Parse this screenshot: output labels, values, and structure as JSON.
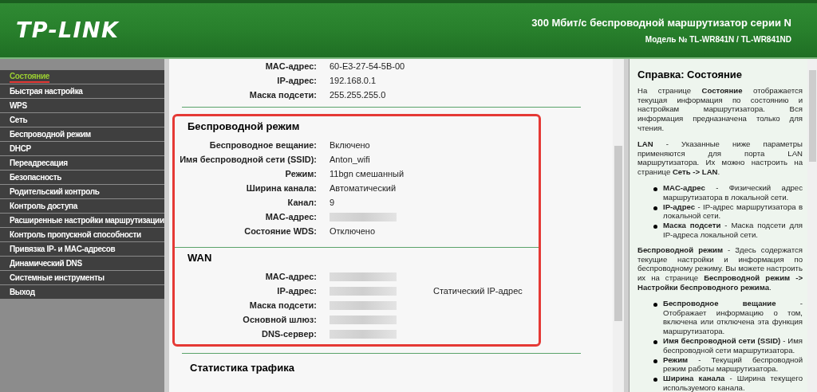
{
  "header": {
    "logo": "TP-LINK",
    "title": "300 Мбит/с беспроводной маршрутизатор серии N",
    "model": "Модель № TL-WR841N / TL-WR841ND"
  },
  "menu": [
    {
      "label": "Состояние",
      "selected": true
    },
    {
      "label": "Быстрая настройка",
      "selected": false
    },
    {
      "label": "WPS",
      "selected": false
    },
    {
      "label": "Сеть",
      "selected": false
    },
    {
      "label": "Беспроводной режим",
      "selected": false
    },
    {
      "label": "DHCP",
      "selected": false
    },
    {
      "label": "Переадресация",
      "selected": false
    },
    {
      "label": "Безопасность",
      "selected": false
    },
    {
      "label": "Родительский контроль",
      "selected": false
    },
    {
      "label": "Контроль доступа",
      "selected": false
    },
    {
      "label": "Расширенные настройки маршрутизации",
      "selected": false
    },
    {
      "label": "Контроль пропускной способности",
      "selected": false
    },
    {
      "label": "Привязка IP- и MAC-адресов",
      "selected": false
    },
    {
      "label": "Динамический DNS",
      "selected": false
    },
    {
      "label": "Системные инструменты",
      "selected": false
    },
    {
      "label": "Выход",
      "selected": false
    }
  ],
  "sections": [
    {
      "highlighted": false,
      "rows": [
        {
          "label": "MAC-адрес:",
          "value": "60-E3-27-54-5B-00"
        },
        {
          "label": "IP-адрес:",
          "value": "192.168.0.1"
        },
        {
          "label": "Маска подсети:",
          "value": "255.255.255.0"
        }
      ]
    },
    {
      "title": "Беспроводной режим",
      "highlighted": true,
      "rows": [
        {
          "label": "Беспроводное вещание:",
          "value": "Включено"
        },
        {
          "label": "Имя беспроводной сети (SSID):",
          "value": "Anton_wifi"
        },
        {
          "label": "Режим:",
          "value": "11bgn смешанный"
        },
        {
          "label": "Ширина канала:",
          "value": "Автоматический"
        },
        {
          "label": "Канал:",
          "value": "9"
        },
        {
          "label": "MAC-адрес:",
          "kind": "redacted"
        },
        {
          "label": "Состояние WDS:",
          "value": "Отключено"
        }
      ]
    },
    {
      "title": "WAN",
      "highlighted": true,
      "rows": [
        {
          "label": "MAC-адрес:",
          "kind": "redacted"
        },
        {
          "label": "IP-адрес:",
          "kind": "redacted",
          "note": "Статический IP-адрес"
        },
        {
          "label": "Маска подсети:",
          "kind": "redacted"
        },
        {
          "label": "Основной шлюз:",
          "kind": "redacted"
        },
        {
          "label": "DNS-сервер:",
          "kind": "redacted"
        }
      ]
    },
    {
      "title": "Статистика трафика",
      "highlighted": false
    }
  ],
  "help": {
    "title": "Справка: Состояние",
    "blocks": [
      {
        "kind": "paragraph",
        "text": "На странице **Состояние** отображается текущая информация по состоянию и настройкам маршрутизатора. Вся информация предназначена только для чтения."
      },
      {
        "kind": "paragraph",
        "text": "**LAN** - Указанные ниже параметры применяются для порта LAN маршрутизатора. Их можно настроить на странице **Сеть -> LAN**."
      },
      {
        "kind": "list",
        "items": [
          "**MAC-адрес** - Физический адрес маршрутизатора в локальной сети.",
          "**IP-адрес** - IP-адрес маршрутизатора в локальной сети.",
          "**Маска подсети** - Маска подсети для IP-адреса локальной сети."
        ]
      },
      {
        "kind": "paragraph",
        "text": "**Беспроводной режим** - Здесь содержатся текущие настройки и информация по беспроводному режиму. Вы можете настроить их на странице **Беспроводной режим -> Настройки беспроводного режима**."
      },
      {
        "kind": "list",
        "items": [
          "**Беспроводное вещание** - Отображает информацию о том, включена или отключена эта функция маршрутизатора.",
          "**Имя беспроводной сети (SSID)** - Имя беспроводной сети маршрутизатора.",
          "**Режим** - Текущий беспроводной режим работы маршрутизатора.",
          "**Ширина канала** - Ширина текущего используемого канала."
        ]
      }
    ]
  }
}
